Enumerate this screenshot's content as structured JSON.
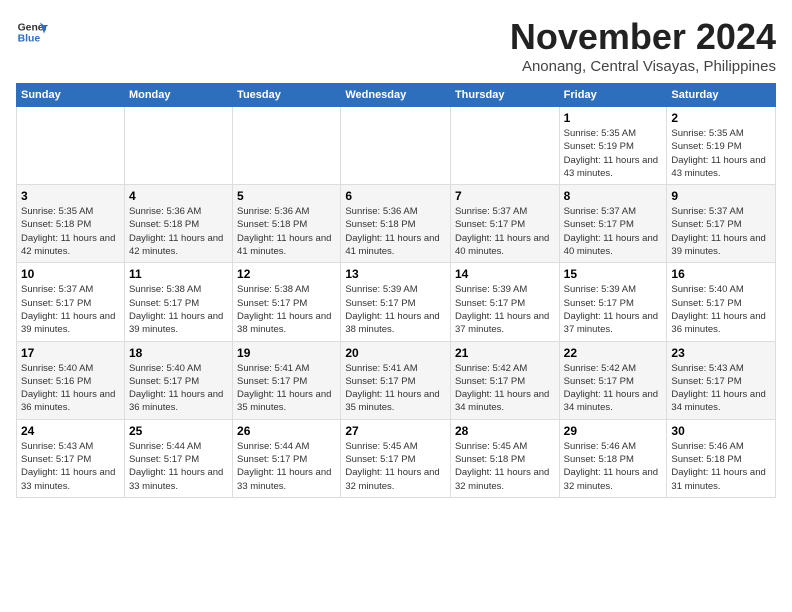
{
  "logo": {
    "line1": "General",
    "line2": "Blue"
  },
  "header": {
    "month": "November 2024",
    "location": "Anonang, Central Visayas, Philippines"
  },
  "weekdays": [
    "Sunday",
    "Monday",
    "Tuesday",
    "Wednesday",
    "Thursday",
    "Friday",
    "Saturday"
  ],
  "weeks": [
    [
      {
        "day": "",
        "info": ""
      },
      {
        "day": "",
        "info": ""
      },
      {
        "day": "",
        "info": ""
      },
      {
        "day": "",
        "info": ""
      },
      {
        "day": "",
        "info": ""
      },
      {
        "day": "1",
        "info": "Sunrise: 5:35 AM\nSunset: 5:19 PM\nDaylight: 11 hours and 43 minutes."
      },
      {
        "day": "2",
        "info": "Sunrise: 5:35 AM\nSunset: 5:19 PM\nDaylight: 11 hours and 43 minutes."
      }
    ],
    [
      {
        "day": "3",
        "info": "Sunrise: 5:35 AM\nSunset: 5:18 PM\nDaylight: 11 hours and 42 minutes."
      },
      {
        "day": "4",
        "info": "Sunrise: 5:36 AM\nSunset: 5:18 PM\nDaylight: 11 hours and 42 minutes."
      },
      {
        "day": "5",
        "info": "Sunrise: 5:36 AM\nSunset: 5:18 PM\nDaylight: 11 hours and 41 minutes."
      },
      {
        "day": "6",
        "info": "Sunrise: 5:36 AM\nSunset: 5:18 PM\nDaylight: 11 hours and 41 minutes."
      },
      {
        "day": "7",
        "info": "Sunrise: 5:37 AM\nSunset: 5:17 PM\nDaylight: 11 hours and 40 minutes."
      },
      {
        "day": "8",
        "info": "Sunrise: 5:37 AM\nSunset: 5:17 PM\nDaylight: 11 hours and 40 minutes."
      },
      {
        "day": "9",
        "info": "Sunrise: 5:37 AM\nSunset: 5:17 PM\nDaylight: 11 hours and 39 minutes."
      }
    ],
    [
      {
        "day": "10",
        "info": "Sunrise: 5:37 AM\nSunset: 5:17 PM\nDaylight: 11 hours and 39 minutes."
      },
      {
        "day": "11",
        "info": "Sunrise: 5:38 AM\nSunset: 5:17 PM\nDaylight: 11 hours and 39 minutes."
      },
      {
        "day": "12",
        "info": "Sunrise: 5:38 AM\nSunset: 5:17 PM\nDaylight: 11 hours and 38 minutes."
      },
      {
        "day": "13",
        "info": "Sunrise: 5:39 AM\nSunset: 5:17 PM\nDaylight: 11 hours and 38 minutes."
      },
      {
        "day": "14",
        "info": "Sunrise: 5:39 AM\nSunset: 5:17 PM\nDaylight: 11 hours and 37 minutes."
      },
      {
        "day": "15",
        "info": "Sunrise: 5:39 AM\nSunset: 5:17 PM\nDaylight: 11 hours and 37 minutes."
      },
      {
        "day": "16",
        "info": "Sunrise: 5:40 AM\nSunset: 5:17 PM\nDaylight: 11 hours and 36 minutes."
      }
    ],
    [
      {
        "day": "17",
        "info": "Sunrise: 5:40 AM\nSunset: 5:16 PM\nDaylight: 11 hours and 36 minutes."
      },
      {
        "day": "18",
        "info": "Sunrise: 5:40 AM\nSunset: 5:17 PM\nDaylight: 11 hours and 36 minutes."
      },
      {
        "day": "19",
        "info": "Sunrise: 5:41 AM\nSunset: 5:17 PM\nDaylight: 11 hours and 35 minutes."
      },
      {
        "day": "20",
        "info": "Sunrise: 5:41 AM\nSunset: 5:17 PM\nDaylight: 11 hours and 35 minutes."
      },
      {
        "day": "21",
        "info": "Sunrise: 5:42 AM\nSunset: 5:17 PM\nDaylight: 11 hours and 34 minutes."
      },
      {
        "day": "22",
        "info": "Sunrise: 5:42 AM\nSunset: 5:17 PM\nDaylight: 11 hours and 34 minutes."
      },
      {
        "day": "23",
        "info": "Sunrise: 5:43 AM\nSunset: 5:17 PM\nDaylight: 11 hours and 34 minutes."
      }
    ],
    [
      {
        "day": "24",
        "info": "Sunrise: 5:43 AM\nSunset: 5:17 PM\nDaylight: 11 hours and 33 minutes."
      },
      {
        "day": "25",
        "info": "Sunrise: 5:44 AM\nSunset: 5:17 PM\nDaylight: 11 hours and 33 minutes."
      },
      {
        "day": "26",
        "info": "Sunrise: 5:44 AM\nSunset: 5:17 PM\nDaylight: 11 hours and 33 minutes."
      },
      {
        "day": "27",
        "info": "Sunrise: 5:45 AM\nSunset: 5:17 PM\nDaylight: 11 hours and 32 minutes."
      },
      {
        "day": "28",
        "info": "Sunrise: 5:45 AM\nSunset: 5:18 PM\nDaylight: 11 hours and 32 minutes."
      },
      {
        "day": "29",
        "info": "Sunrise: 5:46 AM\nSunset: 5:18 PM\nDaylight: 11 hours and 32 minutes."
      },
      {
        "day": "30",
        "info": "Sunrise: 5:46 AM\nSunset: 5:18 PM\nDaylight: 11 hours and 31 minutes."
      }
    ]
  ]
}
